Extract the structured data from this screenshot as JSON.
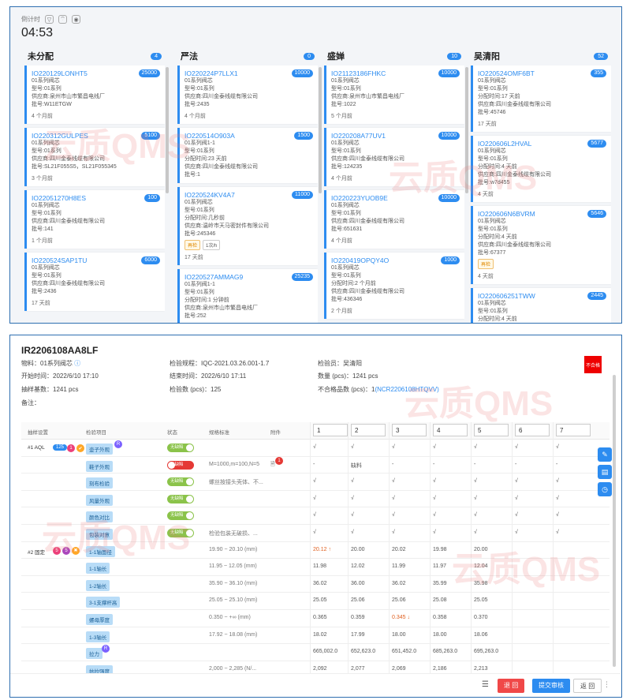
{
  "board": {
    "timer_label": "倒计时",
    "timer_value": "04:53",
    "columns": [
      {
        "title": "未分配",
        "count": "4",
        "cards": [
          {
            "id": "IO220129LONHT5",
            "badge": "25000",
            "lines": [
              "01系列阀芯",
              "型号:01系列",
              "供应商:泉州市山市繁昌电线厂",
              "批号:W11ETGW"
            ],
            "tags": [],
            "time": "4 个月前"
          },
          {
            "id": "IO220312GULPES",
            "badge": "5100",
            "lines": [
              "01系列阀芯",
              "型号:01系列",
              "供应商:四川金泰线缆有限公司",
              "批号:SL21F055S5，SL21F055345"
            ],
            "tags": [],
            "time": "3 个月前"
          },
          {
            "id": "IO22051270H8ES",
            "badge": "100",
            "lines": [
              "01系列阀芯",
              "型号:01系列",
              "供应商:四川金泰线缆有限公司",
              "批号:141"
            ],
            "tags": [],
            "time": "1 个月前"
          },
          {
            "id": "IO220524SAP1TU",
            "badge": "6000",
            "lines": [
              "01系列阀芯",
              "型号:01系列",
              "供应商:四川金泰线缆有限公司",
              "批号:2436"
            ],
            "tags": [],
            "time": "17 天前"
          }
        ]
      },
      {
        "title": "严法",
        "count": "0",
        "cards": [
          {
            "id": "IO220224P7LLX1",
            "badge": "10000",
            "lines": [
              "01系列阀芯",
              "型号:01系列",
              "供应商:四川金泰线缆有限公司",
              "批号:2435"
            ],
            "tags": [],
            "time": "4 个月前"
          },
          {
            "id": "IO220514O903A",
            "badge": "1500",
            "lines": [
              "01系列阀1-1",
              "型号:01系列",
              "分配时间:23 天前",
              "供应商:四川金泰线缆有限公司",
              "批号:1"
            ],
            "tags": [],
            "time": ""
          },
          {
            "id": "IO220524KV4A7",
            "badge": "11000",
            "lines": [
              "01系列阀芯",
              "型号:01系列",
              "分配时间:几秒前",
              "供应商:温岭市天马密封件有限公司",
              "批号:245346"
            ],
            "tags": [
              "再检",
              "1次/h"
            ],
            "time": "17 天前"
          },
          {
            "id": "IO220527AMMAG9",
            "badge": "25235",
            "lines": [
              "01系列阀1-1",
              "型号:01系列",
              "分配时间:1 分钟前",
              "供应商:泉州市山市繁昌电线厂",
              "批号:252"
            ],
            "tags": [],
            "time": ""
          }
        ]
      },
      {
        "title": "盛婵",
        "count": "10",
        "cards": [
          {
            "id": "IO21123186FHKC",
            "badge": "10000",
            "lines": [
              "01系列阀芯",
              "型号:01系列",
              "供应商:泉州市山市繁昌电线厂",
              "批号:1022"
            ],
            "tags": [],
            "time": "5 个月前"
          },
          {
            "id": "IO220208A77UV1",
            "badge": "10000",
            "lines": [
              "01系列阀芯",
              "型号:01系列",
              "供应商:四川金泰线缆有限公司",
              "批号:124235"
            ],
            "tags": [],
            "time": "4 个月前"
          },
          {
            "id": "IO220223YUOB9E",
            "badge": "10000",
            "lines": [
              "01系列阀芯",
              "型号:01系列",
              "供应商:四川金泰线缆有限公司",
              "批号:651631"
            ],
            "tags": [],
            "time": "4 个月前"
          },
          {
            "id": "IO220419OPQY4O",
            "badge": "1000",
            "lines": [
              "01系列阀芯",
              "型号:01系列",
              "分配时间:2 个月前",
              "供应商:四川金泰线缆有限公司",
              "批号:436346"
            ],
            "tags": [],
            "time": "2 个月前"
          }
        ]
      },
      {
        "title": "吴清阳",
        "count": "52",
        "cards": [
          {
            "id": "IO220524OMF6BT",
            "badge": "355",
            "lines": [
              "01系列阀芯",
              "型号:01系列",
              "分配时间:17 天前",
              "供应商:四川金泰线缆有限公司",
              "批号:45746"
            ],
            "tags": [],
            "time": "17 天前"
          },
          {
            "id": "IO220606L2HVAL",
            "badge": "5677",
            "lines": [
              "01系列阀芯",
              "型号:01系列",
              "分配时间:4 天前",
              "供应商:四川金泰线缆有限公司",
              "批号:w7d455"
            ],
            "tags": [],
            "time": "4 天前"
          },
          {
            "id": "IO220606N6BVRM",
            "badge": "5646",
            "lines": [
              "01系列阀芯",
              "型号:01系列",
              "分配时间:4 天前",
              "供应商:四川金泰线缆有限公司",
              "批号:67377"
            ],
            "tags": [
              "再检"
            ],
            "time": "4 天前"
          },
          {
            "id": "IO220606251TWW",
            "badge": "2445",
            "lines": [
              "01系列阀芯",
              "型号:01系列",
              "分配时间:4 天前",
              "供应商:温岭市天马密封件有限公司"
            ],
            "tags": [],
            "time": ""
          }
        ]
      }
    ]
  },
  "watermark": "云质QMS",
  "inspection": {
    "title": "IR2206108AA8LF",
    "material_label": "物料：",
    "material": "01系列阀芯",
    "rule_label": "检验规程：",
    "rule": "IQC-2021.03.26.001-1.7",
    "inspector_label": "检验员：",
    "inspector": "吴清阳",
    "start_label": "开始时间：",
    "start": "2022/6/10 17:10",
    "end_label": "结束时间：",
    "end": "2022/6/10 17:11",
    "qty_label": "数量 (pcs)：",
    "qty": "1241 pcs",
    "sample_label": "抽样基数：",
    "sample": "1241 pcs",
    "checked_label": "检验数 (pcs)：",
    "checked": "125",
    "ng_label": "不合格品数 (pcs)：",
    "ng": "1",
    "ng_link": "(NCR2206108HTQVV)",
    "remark_label": "备注：",
    "fail_badge": "不合格",
    "headers": {
      "sampling": "抽样设置",
      "item": "检验项目",
      "status": "状态",
      "std": "规格标准",
      "attach": "附件"
    },
    "pieces": [
      "1",
      "2",
      "3",
      "4",
      "5",
      "6",
      "7"
    ],
    "groups": [
      {
        "label": "#1 AQL",
        "count": "125",
        "c1": "1",
        "c2": "R"
      },
      {
        "label": "#2 固定",
        "c1": "5",
        "c2": "5"
      }
    ],
    "rows": [
      {
        "item": "壶子外观",
        "status": "无缺陷",
        "st": "on",
        "std": "",
        "vals": [
          "√",
          "√",
          "√",
          "√",
          "√",
          "√",
          "√"
        ],
        "badge": "R"
      },
      {
        "item": "鞋子外观",
        "status": "有缺陷",
        "st": "off",
        "std": "M=1000,m=100,N=5",
        "vals": [
          "-",
          "缺料",
          "-",
          "-",
          "-",
          "-",
          "-"
        ],
        "attach": "1"
      },
      {
        "item": "刻布检验",
        "status": "无缺陷",
        "st": "on",
        "std": "螺丝按接头壳体、不...",
        "vals": [
          "√",
          "√",
          "√",
          "√",
          "√",
          "√",
          "√"
        ]
      },
      {
        "item": "风量外观",
        "status": "无缺陷",
        "st": "on",
        "std": "",
        "vals": [
          "√",
          "√",
          "√",
          "√",
          "√",
          "√",
          "√"
        ]
      },
      {
        "item": "颜色对比",
        "status": "无缺陷",
        "st": "on",
        "std": "",
        "vals": [
          "√",
          "√",
          "√",
          "√",
          "√",
          "√",
          "√"
        ]
      },
      {
        "item": "包装对意",
        "status": "无缺陷",
        "st": "on",
        "std": "检验包装无破损、...",
        "vals": [
          "√",
          "√",
          "√",
          "√",
          "√",
          "√",
          "√"
        ]
      },
      {
        "item": "1-1轴面径",
        "std": "19.90 ~ 20.10 (mm)",
        "vals": [
          "20.12 ↑",
          "20.00",
          "20.02",
          "19.98",
          "20.00",
          "",
          ""
        ],
        "red": [
          0
        ]
      },
      {
        "item": "1-1轴长",
        "std": "11.95 ~ 12.05 (mm)",
        "vals": [
          "11.98",
          "12.02",
          "11.99",
          "11.97",
          "12.04",
          "",
          ""
        ]
      },
      {
        "item": "1-2轴长",
        "std": "35.90 ~ 36.10 (mm)",
        "vals": [
          "36.02",
          "36.00",
          "36.02",
          "35.99",
          "35.98",
          "",
          ""
        ]
      },
      {
        "item": "3-1支撑杆高",
        "std": "25.05 ~ 25.10 (mm)",
        "vals": [
          "25.05",
          "25.06",
          "25.06",
          "25.08",
          "25.05",
          "",
          ""
        ]
      },
      {
        "item": "螺母厚度",
        "std": "0.350 ~ +∞ (mm)",
        "vals": [
          "0.365",
          "0.359",
          "0.345 ↓",
          "0.358",
          "0.370",
          "",
          ""
        ],
        "red": [
          2
        ]
      },
      {
        "item": "1-3轴长",
        "std": "17.92 ~ 18.08 (mm)",
        "vals": [
          "18.02",
          "17.99",
          "18.00",
          "18.00",
          "18.06",
          "",
          ""
        ]
      },
      {
        "item": "拉力",
        "std": "",
        "vals": [
          "665,002.0",
          "652,623.0",
          "651,452.0",
          "685,263.0",
          "695,263.0",
          "",
          ""
        ],
        "badge": "R"
      },
      {
        "item": "抗拉强度",
        "std": "2,000 ~ 2,285 (N/...",
        "vals": [
          "2,092",
          "2,077",
          "2,069",
          "2,186",
          "2,213",
          "",
          ""
        ]
      }
    ],
    "footer": {
      "reject": "退 回",
      "submit": "提交审核",
      "back": "返 回"
    }
  }
}
